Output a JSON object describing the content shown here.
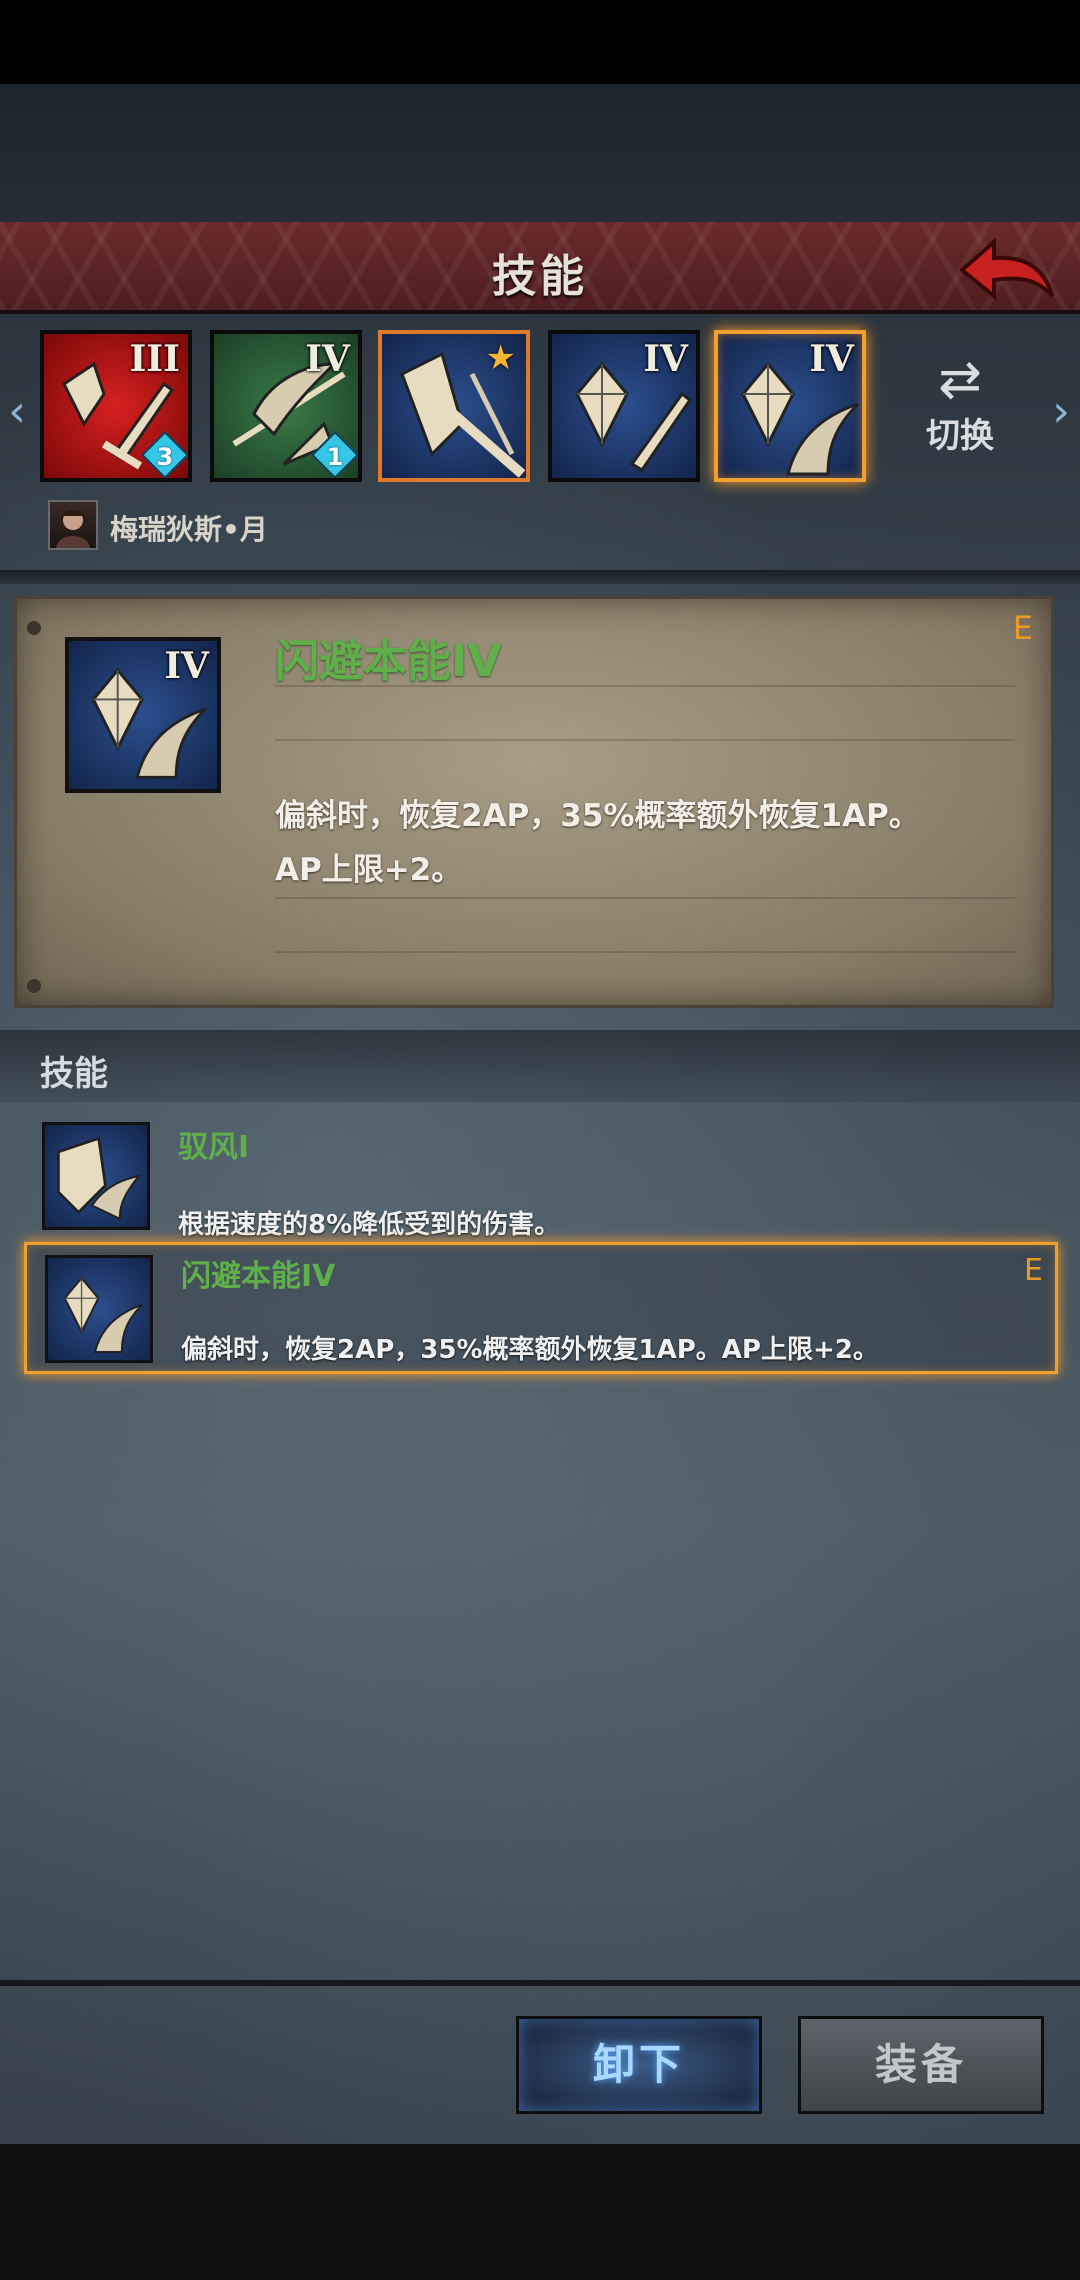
{
  "header": {
    "title": "技能"
  },
  "slots": [
    {
      "color": "red",
      "level": "III",
      "badge": "3"
    },
    {
      "color": "green",
      "level": "IV",
      "badge": "1"
    },
    {
      "color": "blue",
      "level": "",
      "star": "★"
    },
    {
      "color": "blue",
      "level": "IV"
    },
    {
      "color": "blue",
      "level": "IV"
    }
  ],
  "switch": {
    "label": "切换",
    "icon": "⇄"
  },
  "hero": {
    "name": "梅瑞狄斯•月"
  },
  "detail": {
    "title": "闪避本能IV",
    "level": "IV",
    "mark": "E",
    "desc_line1": "偏斜时，恢复2AP，35%概率额外恢复1AP。",
    "desc_line2": "AP上限+2。"
  },
  "list": {
    "header": "技能",
    "items": [
      {
        "name": "驭风I",
        "desc": "根据速度的8%降低受到的伤害。",
        "mark": ""
      },
      {
        "name": "闪避本能IV",
        "desc": "偏斜时，恢复2AP，35%概率额外恢复1AP。AP上限+2。",
        "mark": "E"
      }
    ]
  },
  "buttons": {
    "unequip": "卸下",
    "equip": "装备"
  },
  "colors": {
    "accent_green": "#5fb04a",
    "selection_orange": "#f0a030",
    "header_red": "#6b2a2a"
  }
}
